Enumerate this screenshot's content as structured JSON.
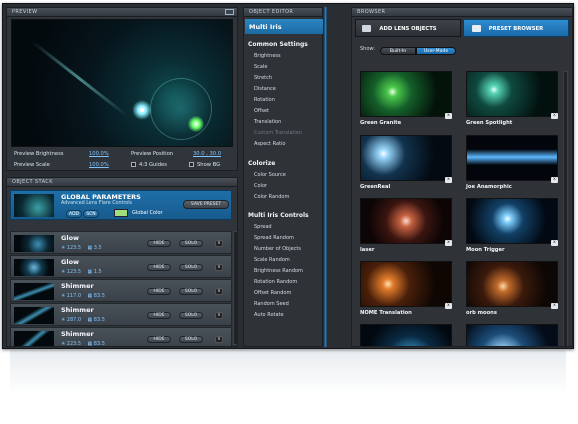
{
  "preview": {
    "title": "Preview",
    "brightness_label": "Preview Brightness",
    "brightness_value": "100.0%",
    "position_label": "Preview Position",
    "position_value": "30.0 , 30.0",
    "scale_label": "Preview Scale",
    "scale_value": "100.0%",
    "guides_label": "4:3 Guides",
    "showbg_label": "Show BG"
  },
  "object_stack": {
    "title": "Object Stack",
    "global": {
      "title": "GLOBAL PARAMETERS",
      "subtitle": "Advanced Lens Flare Controls",
      "add_label": "ADD",
      "scn_label": "SCN",
      "color_label": "Global Color",
      "save_label": "SAVE PRESET",
      "color": "#9fe07a"
    },
    "hide_label": "HIDE",
    "solo_label": "SOLO",
    "x_label": "x",
    "layers": [
      {
        "name": "Glow",
        "v1": "123.5",
        "v2": "3.5"
      },
      {
        "name": "Glow",
        "v1": "123.5",
        "v2": "1.5"
      },
      {
        "name": "Shimmer",
        "v1": "117.0",
        "v2": "83.5"
      },
      {
        "name": "Shimmer",
        "v1": "287.0",
        "v2": "83.5"
      },
      {
        "name": "Shimmer",
        "v1": "223.5",
        "v2": "83.5"
      }
    ]
  },
  "object_editor": {
    "title": "Object Editor",
    "effect_name": "Multi Iris",
    "sections": [
      {
        "title": "Common Settings",
        "items": [
          {
            "label": "Brightness",
            "enabled": true
          },
          {
            "label": "Scale",
            "enabled": true
          },
          {
            "label": "Stretch",
            "enabled": true
          },
          {
            "label": "Distance",
            "enabled": true
          },
          {
            "label": "Rotation",
            "enabled": true
          },
          {
            "label": "Offset",
            "enabled": true
          },
          {
            "label": "Translation",
            "enabled": true
          },
          {
            "label": "Custom Translation",
            "enabled": false
          },
          {
            "label": "Aspect Ratio",
            "enabled": true
          }
        ]
      },
      {
        "title": "Colorize",
        "items": [
          {
            "label": "Color Source",
            "enabled": true
          },
          {
            "label": "Color",
            "enabled": true
          },
          {
            "label": "Color Random",
            "enabled": true
          }
        ]
      },
      {
        "title": "Multi Iris Controls",
        "items": [
          {
            "label": "Spread",
            "enabled": true
          },
          {
            "label": "Spread Random",
            "enabled": true
          },
          {
            "label": "Number of Objects",
            "enabled": true
          },
          {
            "label": "Scale Random",
            "enabled": true
          },
          {
            "label": "Brightness Random",
            "enabled": true
          },
          {
            "label": "Rotation Random",
            "enabled": true
          },
          {
            "label": "Offset Random",
            "enabled": true
          },
          {
            "label": "Random Seed",
            "enabled": true
          },
          {
            "label": "Auto Rotate",
            "enabled": true
          }
        ]
      }
    ]
  },
  "browser": {
    "title": "Browser",
    "tab_add": "ADD LENS OBJECTS",
    "tab_preset": "PRESET BROWSER",
    "show_label": "Show:",
    "builtin_label": "Built-In",
    "usermade_label": "User-Made",
    "x_label": "x",
    "items": [
      {
        "name": "Green Granite"
      },
      {
        "name": "Green Spotlight"
      },
      {
        "name": "GreenReal"
      },
      {
        "name": "Joe Anamorphic"
      },
      {
        "name": "laser"
      },
      {
        "name": "Moon Trigger"
      },
      {
        "name": "NOME Translation"
      },
      {
        "name": "orb moons"
      },
      {
        "name": ""
      },
      {
        "name": ""
      }
    ]
  }
}
